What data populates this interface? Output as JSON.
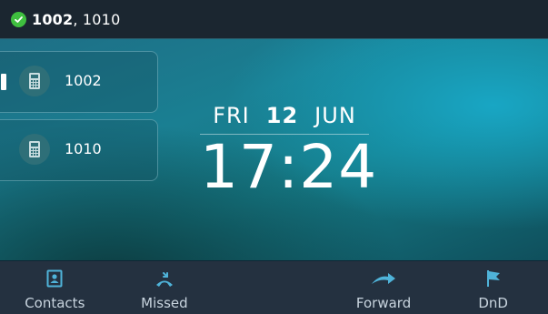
{
  "status_bar": {
    "registered_icon": "check-circle-icon",
    "primary_line": "1002",
    "separator": ",",
    "other_lines": " 1010",
    "colors": {
      "background": "#1b2630",
      "check": "#3fbf3f"
    }
  },
  "lines": [
    {
      "label": "1002",
      "icon": "deskphone-icon",
      "active": true
    },
    {
      "label": "1010",
      "icon": "deskphone-icon",
      "active": false
    }
  ],
  "clock": {
    "weekday": "FRI",
    "day": "12",
    "month": "JUN",
    "time": "17:24"
  },
  "softkeys": [
    {
      "label": "Contacts",
      "icon": "contacts-book-icon"
    },
    {
      "label": "Missed",
      "icon": "missed-call-icon"
    },
    {
      "label": "",
      "icon": ""
    },
    {
      "label": "Forward",
      "icon": "forward-arrow-icon"
    },
    {
      "label": "DnD",
      "icon": "flag-icon"
    }
  ],
  "colors": {
    "accent": "#2aa4c8",
    "softkey_bar": "#243140",
    "softkey_text": "#c8d4de"
  }
}
